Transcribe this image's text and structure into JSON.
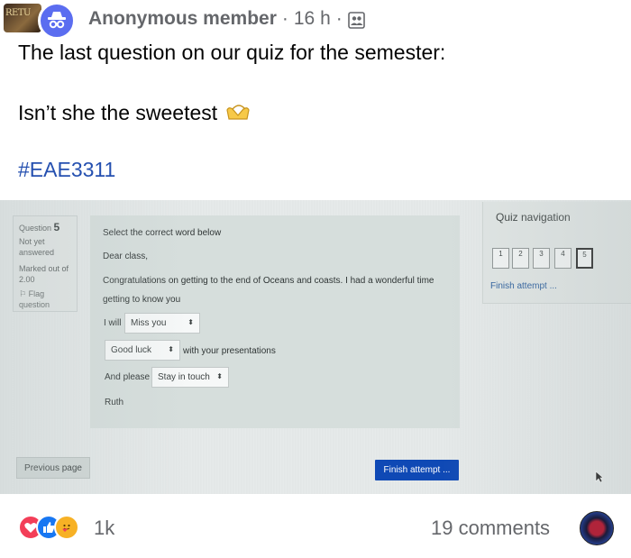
{
  "post": {
    "group_avatar_text": "RETU",
    "author": "Anonymous member",
    "separator": "·",
    "time": "16 h",
    "separator2": "·",
    "audience_icon": "group-members-icon",
    "line1": "The last question on our quiz for the semester:",
    "line2": "Isn’t she the sweetest",
    "heart_hands_emoji": "🫶",
    "hashtag": "#EAE3311"
  },
  "quiz": {
    "question_label": "Question",
    "question_number": "5",
    "status": "Not yet answered",
    "marked": "Marked out of 2.00",
    "flag": "Flag question",
    "instruction": "Select the correct word below",
    "greeting": "Dear class,",
    "body_line1": "Congratulations on getting to the end of Oceans and coasts. I had a wonderful time",
    "body_line2": "getting to know you",
    "i_will": "I will",
    "select1": "Miss you",
    "select2": "Good luck",
    "with_presentations": "with your presentations",
    "and_please": "And please",
    "select3": "Stay in touch",
    "signature": "Ruth",
    "nav_title": "Quiz navigation",
    "nav_boxes": [
      "1",
      "2",
      "3",
      "4",
      "5"
    ],
    "finish_link": "Finish attempt ...",
    "prev_button": "Previous page",
    "finish_button": "Finish attempt ..."
  },
  "footer": {
    "reactions": [
      "love-icon",
      "like-icon",
      "care-icon"
    ],
    "reaction_count": "1k",
    "comments": "19 comments"
  },
  "colors": {
    "hashtag": "#2550b0",
    "anon_avatar": "#5b6df0",
    "finish_button": "#0f49b5",
    "love": "#f33e58",
    "like": "#1877f2",
    "care": "#f7b125"
  }
}
